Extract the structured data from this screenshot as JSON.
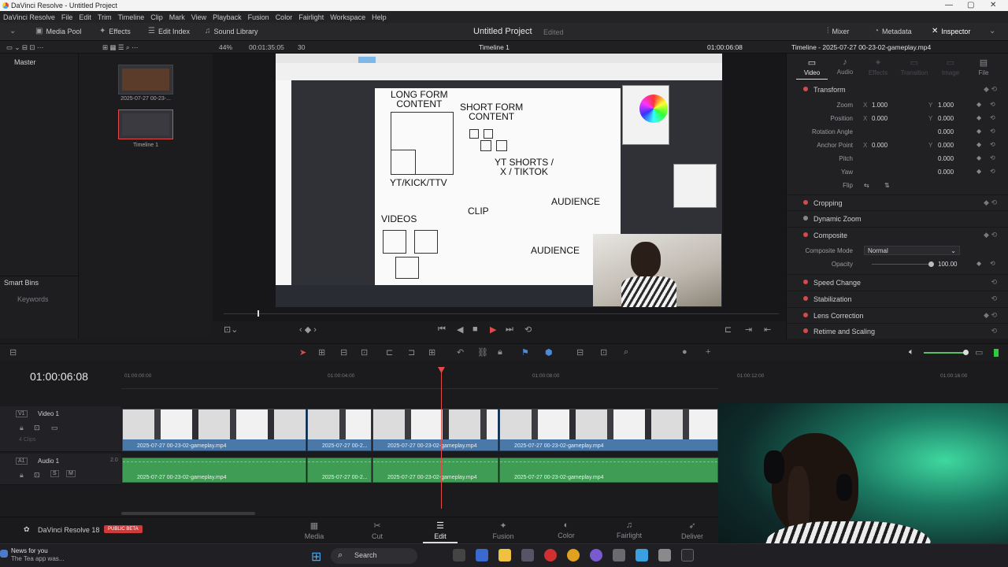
{
  "window": {
    "title": "DaVinci Resolve - Untitled Project"
  },
  "menu": [
    "DaVinci Resolve",
    "File",
    "Edit",
    "Trim",
    "Timeline",
    "Clip",
    "Mark",
    "View",
    "Playback",
    "Fusion",
    "Color",
    "Fairlight",
    "Workspace",
    "Help"
  ],
  "toolbar": {
    "media_pool": "Media Pool",
    "effects": "Effects",
    "edit_index": "Edit Index",
    "sound_library": "Sound Library",
    "project_title": "Untitled Project",
    "project_status": "Edited",
    "mixer": "Mixer",
    "metadata": "Metadata",
    "inspector": "Inspector"
  },
  "subbar": {
    "zoom": "44%",
    "source_tc": "00:01:35:05",
    "fps": "30",
    "timeline_name": "Timeline 1",
    "record_tc": "01:00:06:08",
    "inspector_title": "Timeline - 2025-07-27 00-23-02-gameplay.mp4"
  },
  "bins": {
    "master": "Master",
    "smart_bins": "Smart Bins",
    "keywords": "Keywords"
  },
  "clips": [
    {
      "label": "2025-07-27 00-23-..."
    },
    {
      "label": "Timeline 1"
    }
  ],
  "canvas_text": {
    "long_form": "LONG FORM\nCONTENT",
    "short_form": "SHORT FORM\nCONTENT",
    "yt_shorts": "YT SHORTS /\nX / TIKTOK",
    "yt_kick": "YT/KICK/TTV",
    "videos": "VIDEOS",
    "clip": "CLIP",
    "audience1": "AUDIENCE",
    "audience2": "AUDIENCE"
  },
  "inspector": {
    "tabs": [
      "Video",
      "Audio",
      "Effects",
      "Transition",
      "Image",
      "File"
    ],
    "transform": "Transform",
    "props": [
      {
        "label": "Zoom",
        "x": "1.000",
        "y": "1.000"
      },
      {
        "label": "Position",
        "x": "0.000",
        "y": "0.000"
      },
      {
        "label": "Rotation Angle",
        "y": "0.000"
      },
      {
        "label": "Anchor Point",
        "x": "0.000",
        "y": "0.000"
      },
      {
        "label": "Pitch",
        "y": "0.000"
      },
      {
        "label": "Yaw",
        "y": "0.000"
      },
      {
        "label": "Flip"
      }
    ],
    "sections": [
      "Cropping",
      "Dynamic Zoom",
      "Composite"
    ],
    "composite_mode_label": "Composite Mode",
    "composite_mode": "Normal",
    "opacity_label": "Opacity",
    "opacity": "100.00",
    "more_sections": [
      "Speed Change",
      "Stabilization",
      "Lens Correction",
      "Retime and Scaling"
    ]
  },
  "timeline": {
    "timecode": "01:00:06:08",
    "ticks": [
      "01:00:00:00",
      "01:00:04:00",
      "01:00:08:00",
      "01:00:12:00",
      "01:00:16:00"
    ],
    "video_track": {
      "id": "V1",
      "name": "Video 1",
      "clips_count": "4 Clips"
    },
    "audio_track": {
      "id": "A1",
      "name": "Audio 1",
      "level": "2.0"
    },
    "video_clips": [
      "2025-07-27 00-23-02-gameplay.mp4",
      "2025-07-27 00-2...",
      "2025-07-27 00-23-02-gameplay.mp4",
      "2025-07-27 00-23-02-gameplay.mp4"
    ],
    "audio_clips": [
      "2025-07-27 00-23-02-gameplay.mp4",
      "2025-07-27 00-2...",
      "2025-07-27 00-23-02-gameplay.mp4",
      "2025-07-27 00-23-02-gameplay.mp4"
    ]
  },
  "pages": {
    "app": "DaVinci Resolve 18",
    "badge": "PUBLIC BETA",
    "tabs": [
      "Media",
      "Cut",
      "Edit",
      "Fusion",
      "Color",
      "Fairlight",
      "Deliver"
    ],
    "active": "Edit"
  },
  "taskbar": {
    "news_title": "News for you",
    "news_sub": "The Tea app was...",
    "search": "Search"
  },
  "colors": {
    "accent": "#e24a4a",
    "video_clip": "#4a78a8",
    "audio_clip": "#3e9c55"
  }
}
